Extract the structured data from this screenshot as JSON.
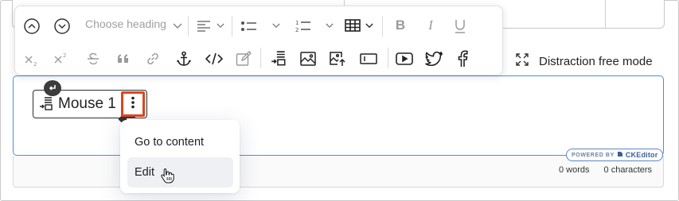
{
  "toolbar": {
    "heading_placeholder": "Choose heading",
    "row1": [
      {
        "name": "collapse-up-icon",
        "label": "Move up"
      },
      {
        "name": "expand-down-icon",
        "label": "Move down"
      },
      {
        "name": "align-icon"
      },
      {
        "name": "bulleted-list-icon"
      },
      {
        "name": "numbered-list-icon"
      },
      {
        "name": "table-icon"
      },
      {
        "name": "bold-icon"
      },
      {
        "name": "italic-icon"
      },
      {
        "name": "underline-icon"
      }
    ],
    "row2": [
      {
        "name": "subscript-icon"
      },
      {
        "name": "superscript-icon"
      },
      {
        "name": "strikethrough-icon"
      },
      {
        "name": "blockquote-icon"
      },
      {
        "name": "link-icon"
      },
      {
        "name": "anchor-icon"
      },
      {
        "name": "code-icon"
      },
      {
        "name": "edit-source-icon"
      },
      {
        "name": "insert-step-icon"
      },
      {
        "name": "image-icon"
      },
      {
        "name": "upload-image-icon"
      },
      {
        "name": "text-field-icon"
      },
      {
        "name": "youtube-icon"
      },
      {
        "name": "twitter-icon"
      },
      {
        "name": "facebook-icon"
      }
    ]
  },
  "distraction": {
    "label": "Distraction free mode",
    "icon": "expand-arrows-icon"
  },
  "editor": {
    "chip_label": "Mouse 1",
    "chip_icon": "step-icon",
    "badge_icon": "return-arrow-icon",
    "kebab_icon": "vertical-dots-icon"
  },
  "context_menu": {
    "items": [
      {
        "label": "Go to content"
      },
      {
        "label": "Edit"
      }
    ]
  },
  "powered_by": {
    "prefix": "POWERED BY",
    "brand": "CKEditor"
  },
  "status": {
    "words": "0 words",
    "characters": "0 characters"
  },
  "colors": {
    "accent_blue": "#4a8fe0",
    "highlight_orange": "#e0461c",
    "text_dark": "#222222"
  }
}
